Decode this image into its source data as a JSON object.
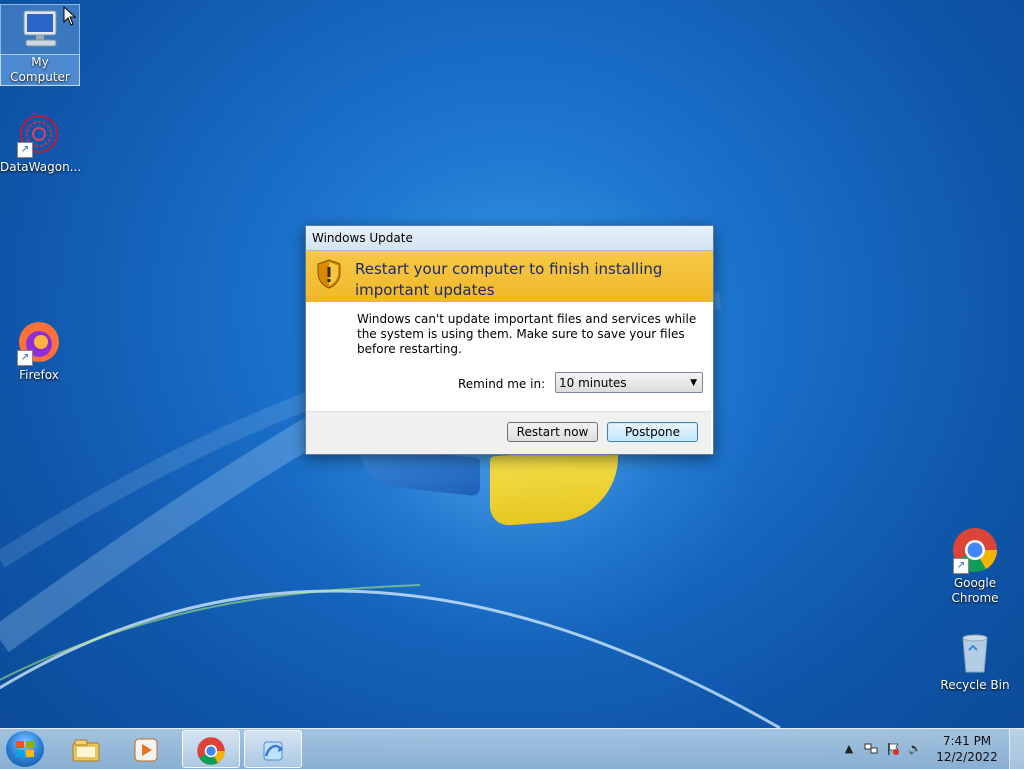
{
  "desktop": {
    "icons": [
      {
        "label": "My Computer"
      },
      {
        "label": "DataWagon..."
      },
      {
        "label": "Firefox"
      },
      {
        "label": "Google Chrome"
      },
      {
        "label": "Recycle Bin"
      }
    ]
  },
  "dialog": {
    "title": "Windows Update",
    "heading": "Restart your computer to finish installing important updates",
    "message": "Windows can't update important files and services while the system is using them. Make sure to save your files before restarting.",
    "remind_label": "Remind me in:",
    "remind_value": "10 minutes",
    "restart_button": "Restart now",
    "postpone_button": "Postpone",
    "banner_color": "#f0b82b"
  },
  "taskbar": {
    "pinned": [
      {
        "icon": "start-orb"
      },
      {
        "icon": "file-explorer-icon"
      },
      {
        "icon": "media-player-icon"
      },
      {
        "icon": "chrome-icon"
      },
      {
        "icon": "windows-update-icon"
      }
    ],
    "clock": {
      "time": "7:41 PM",
      "date": "12/2/2022"
    }
  }
}
